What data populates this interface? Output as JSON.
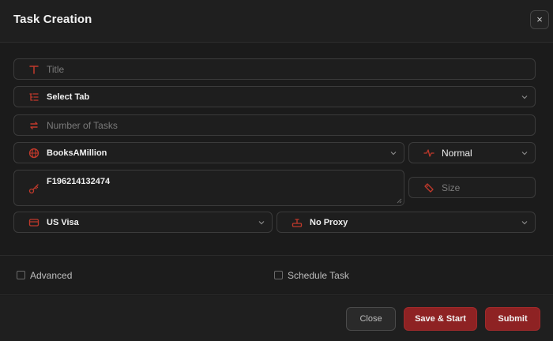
{
  "dialog": {
    "title": "Task Creation",
    "close_symbol": "×"
  },
  "form": {
    "title": {
      "placeholder": "Title",
      "icon": "text-icon"
    },
    "tab": {
      "value": "Select Tab",
      "icon": "list-icon"
    },
    "tasks": {
      "placeholder": "Number of Tasks",
      "icon": "repeat-icon"
    },
    "site": {
      "value": "BooksAMillion",
      "icon": "globe-icon"
    },
    "mode": {
      "value": "Normal",
      "icon": "pulse-icon"
    },
    "key": {
      "value": "F196214132474",
      "icon": "key-icon"
    },
    "size": {
      "placeholder": "Size",
      "icon": "tag-icon"
    },
    "payment": {
      "value": "US Visa",
      "icon": "card-icon"
    },
    "proxy": {
      "value": "No Proxy",
      "icon": "router-icon"
    }
  },
  "options": {
    "advanced": "Advanced",
    "schedule": "Schedule Task"
  },
  "buttons": {
    "close": "Close",
    "save_start": "Save & Start",
    "submit": "Submit"
  },
  "colors": {
    "accent": "#8e2223",
    "icon_red": "#c0392b",
    "background": "#1c1c1c"
  }
}
